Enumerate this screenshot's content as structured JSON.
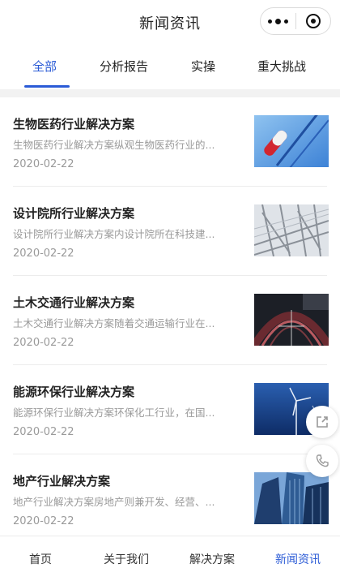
{
  "header": {
    "title": "新闻资讯"
  },
  "tabs": [
    {
      "label": "全部",
      "active": true
    },
    {
      "label": "分析报告",
      "active": false
    },
    {
      "label": "实操",
      "active": false
    },
    {
      "label": "重大挑战",
      "active": false
    }
  ],
  "articles": [
    {
      "title": "生物医药行业解决方案",
      "desc": "生物医药行业解决方案纵观生物医药行业的...",
      "date": "2020-02-22"
    },
    {
      "title": "设计院所行业解决方案",
      "desc": "设计院所行业解决方案内设计院所在科技建...",
      "date": "2020-02-22"
    },
    {
      "title": "土木交通行业解决方案",
      "desc": "土木交通行业解决方案随着交通运输行业在...",
      "date": "2020-02-22"
    },
    {
      "title": "能源环保行业解决方案",
      "desc": "能源环保行业解决方案环保化工行业，在国...",
      "date": "2020-02-22"
    },
    {
      "title": "地产行业解决方案",
      "desc": "地产行业解决方案房地产则兼开发、经营、...",
      "date": "2020-02-22"
    }
  ],
  "bottom_nav": [
    {
      "label": "首页",
      "active": false
    },
    {
      "label": "关于我们",
      "active": false
    },
    {
      "label": "解决方案",
      "active": false
    },
    {
      "label": "新闻资讯",
      "active": true
    }
  ],
  "colors": {
    "accent": "#2b5bd6",
    "muted": "#9a9a9a"
  }
}
